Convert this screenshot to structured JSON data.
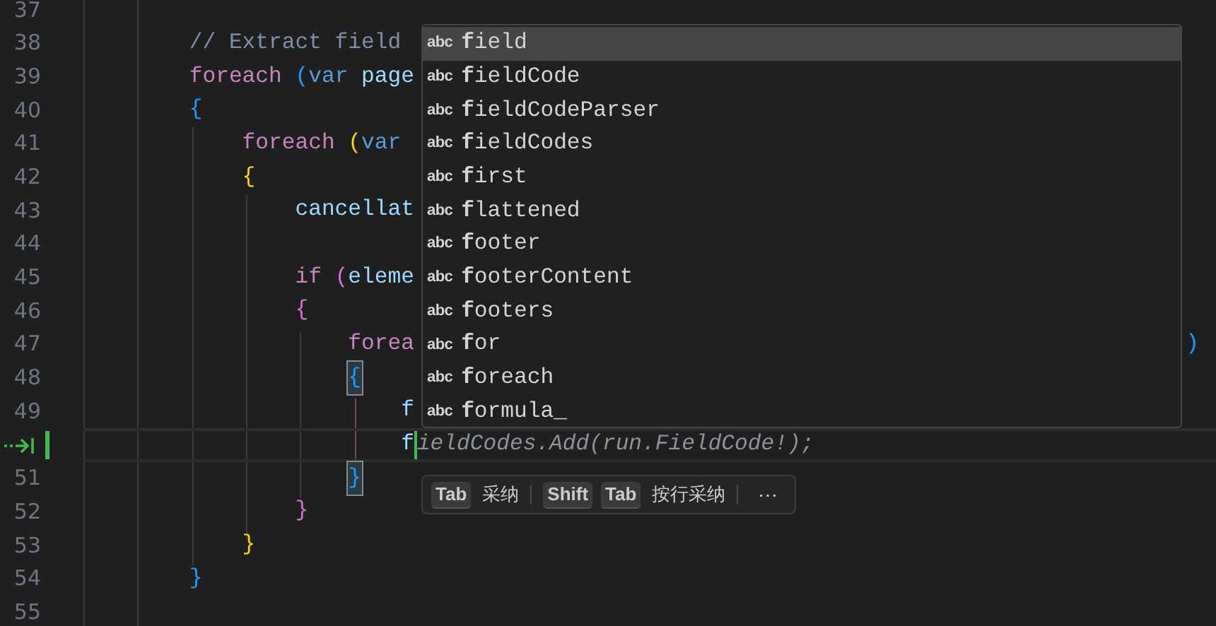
{
  "editor": {
    "lines": [
      {
        "number": "37",
        "current": false
      },
      {
        "number": "38",
        "current": false,
        "tokens": [
          {
            "text": "        // Extract field",
            "kind": "comment"
          }
        ]
      },
      {
        "number": "39",
        "current": false,
        "tokens": [
          {
            "text": "        foreach ",
            "kind": "control"
          },
          {
            "text": "(",
            "kind": "bracket_blue"
          },
          {
            "text": "var ",
            "kind": "keyword"
          },
          {
            "text": "page",
            "kind": "variable"
          }
        ]
      },
      {
        "number": "40",
        "current": false,
        "tokens": [
          {
            "text": "        {",
            "kind": "bracket_blue"
          }
        ]
      },
      {
        "number": "41",
        "current": false,
        "tokens": [
          {
            "text": "            foreach ",
            "kind": "control"
          },
          {
            "text": "(",
            "kind": "bracket_gold"
          },
          {
            "text": "var",
            "kind": "keyword"
          }
        ]
      },
      {
        "number": "42",
        "current": false,
        "tokens": [
          {
            "text": "            {",
            "kind": "bracket_gold"
          }
        ]
      },
      {
        "number": "43",
        "current": false,
        "tokens": [
          {
            "text": "                cancellat",
            "kind": "variable"
          }
        ]
      },
      {
        "number": "44",
        "current": false
      },
      {
        "number": "45",
        "current": false,
        "tokens": [
          {
            "text": "                if ",
            "kind": "control"
          },
          {
            "text": "(",
            "kind": "bracket_pink"
          },
          {
            "text": "eleme",
            "kind": "variable"
          }
        ]
      },
      {
        "number": "46",
        "current": false,
        "tokens": [
          {
            "text": "                {",
            "kind": "bracket_pink"
          }
        ]
      },
      {
        "number": "47",
        "current": false,
        "tokens": [
          {
            "text": "                    forea",
            "kind": "control"
          }
        ],
        "tail": {
          "text": ")",
          "kind": "bracket_blue"
        }
      },
      {
        "number": "48",
        "current": false,
        "tokens": [
          {
            "text": "                    {",
            "kind": "bracket_blue",
            "matched": true
          }
        ]
      },
      {
        "number": "49",
        "current": false,
        "tokens": [
          {
            "text": "                        f",
            "kind": "variable"
          }
        ]
      },
      {
        "current": true,
        "tokens": [
          {
            "text": "                        f",
            "kind": "variable"
          },
          {
            "text": "ieldCodes.Add(run.FieldCode!);",
            "kind": "ghost"
          }
        ]
      },
      {
        "number": "51",
        "current": false,
        "tokens": [
          {
            "text": "                    }",
            "kind": "bracket_blue",
            "matched": true
          }
        ]
      },
      {
        "number": "52",
        "current": false,
        "tokens": [
          {
            "text": "                }",
            "kind": "bracket_pink"
          }
        ]
      },
      {
        "number": "53",
        "current": false,
        "tokens": [
          {
            "text": "            }",
            "kind": "bracket_gold"
          }
        ]
      },
      {
        "number": "54",
        "current": false,
        "tokens": [
          {
            "text": "        }",
            "kind": "bracket_blue"
          }
        ]
      },
      {
        "number": "55",
        "current": false
      }
    ]
  },
  "suggestions": {
    "items": [
      {
        "icon_text": "abc",
        "label": "**f**ield",
        "selected": true
      },
      {
        "icon_text": "abc",
        "label": "**f**ieldCode",
        "selected": false
      },
      {
        "icon_text": "abc",
        "label": "**f**ieldCodeParser",
        "selected": false
      },
      {
        "icon_text": "abc",
        "label": "**f**ieldCodes",
        "selected": false
      },
      {
        "icon_text": "abc",
        "label": "**f**irst",
        "selected": false
      },
      {
        "icon_text": "abc",
        "label": "**f**lattened",
        "selected": false
      },
      {
        "icon_text": "abc",
        "label": "**f**ooter",
        "selected": false
      },
      {
        "icon_text": "abc",
        "label": "**f**ooterContent",
        "selected": false
      },
      {
        "icon_text": "abc",
        "label": "**f**ooters",
        "selected": false
      },
      {
        "icon_text": "abc",
        "label": "**f**or",
        "selected": false
      },
      {
        "icon_text": "abc",
        "label": "**f**oreach",
        "selected": false
      },
      {
        "icon_text": "abc",
        "label": "**f**ormula_",
        "selected": false
      }
    ]
  },
  "inline_hint": {
    "actions": [
      {
        "keys": [
          "Tab"
        ],
        "label": "采纳"
      },
      {
        "keys": [
          "Shift",
          "Tab"
        ],
        "label": "按行采纳"
      }
    ],
    "more": "⋯"
  }
}
